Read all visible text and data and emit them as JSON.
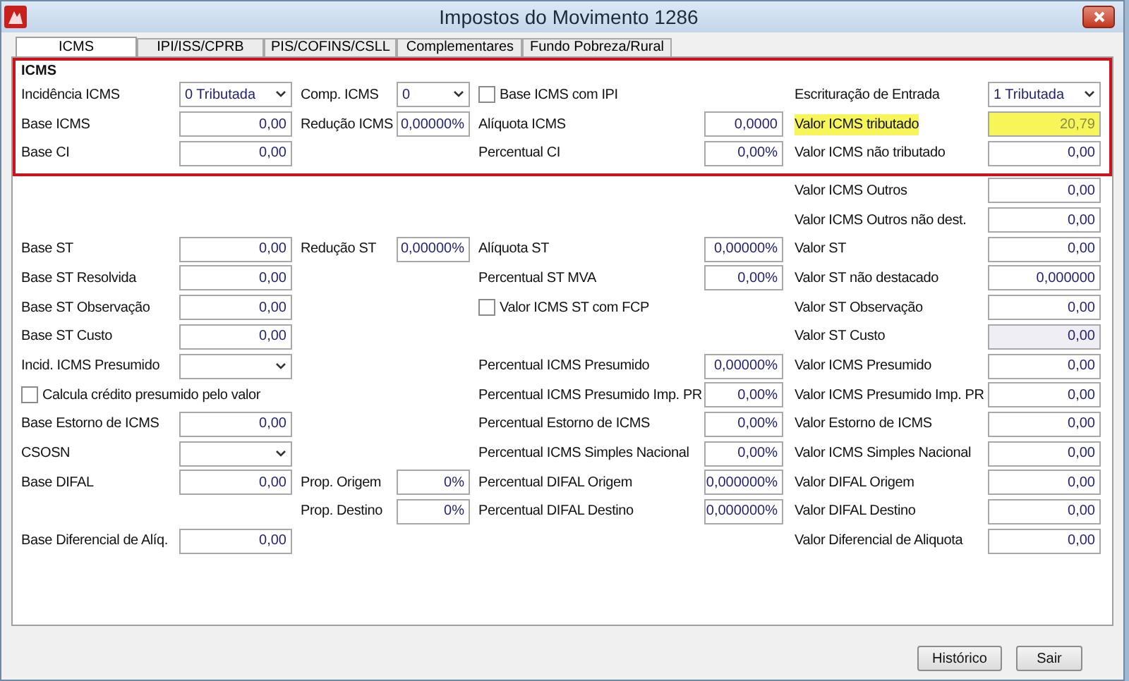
{
  "window": {
    "title": "Impostos do Movimento 1286"
  },
  "tabs": [
    {
      "label": "ICMS",
      "selected": true
    },
    {
      "label": "IPI/ISS/CPRB",
      "selected": false
    },
    {
      "label": "PIS/COFINS/CSLL",
      "selected": false
    },
    {
      "label": "Complementares",
      "selected": false
    },
    {
      "label": "Fundo Pobreza/Rural",
      "selected": false
    }
  ],
  "group": {
    "title": "ICMS",
    "outlined": true,
    "rows": [
      {
        "col_1": {
          "kind": "combo",
          "label": "Incidência ICMS",
          "value": "0 Tributada"
        },
        "col_2": {
          "kind": "combo",
          "label": "Comp. ICMS",
          "value": "0"
        },
        "col_3": {
          "kind": "checkbox",
          "label": "Base ICMS com IPI",
          "checked": false
        },
        "col_4": {
          "kind": "combo",
          "label": "Escrituração de Entrada",
          "value": "1 Tributada"
        }
      },
      {
        "col_1": {
          "kind": "field",
          "label": "Base ICMS",
          "value": "0,00"
        },
        "col_2": {
          "kind": "field",
          "label": "Redução ICMS",
          "value": "0,00000%"
        },
        "col_3": {
          "kind": "field",
          "label": "Alíquota ICMS",
          "value": "0,0000"
        },
        "col_4": {
          "kind": "field",
          "label": "Valor ICMS tributado",
          "value": "20,79",
          "highlighted": true
        }
      },
      {
        "col_1": {
          "kind": "field",
          "label": "Base CI",
          "value": "0,00"
        },
        "col_3": {
          "kind": "field",
          "label": "Percentual CI",
          "value": "0,00%"
        },
        "col_4": {
          "kind": "field",
          "label": "Valor ICMS não tributado",
          "value": "0,00"
        }
      }
    ]
  },
  "rows": [
    {
      "col_4": {
        "kind": "field",
        "label": "Valor ICMS Outros",
        "value": "0,00"
      }
    },
    {
      "col_4": {
        "kind": "field",
        "label": "Valor ICMS Outros não dest.",
        "value": "0,00"
      }
    },
    {
      "col_1": {
        "kind": "field",
        "label": "Base ST",
        "value": "0,00"
      },
      "col_2": {
        "kind": "field",
        "label": "Redução ST",
        "value": "0,00000%"
      },
      "col_3": {
        "kind": "field",
        "label": "Alíquota ST",
        "value": "0,00000%"
      },
      "col_4": {
        "kind": "field",
        "label": "Valor ST",
        "value": "0,00"
      }
    },
    {
      "col_1": {
        "kind": "field",
        "label": "Base ST Resolvida",
        "value": "0,00"
      },
      "col_3": {
        "kind": "field",
        "label": "Percentual ST MVA",
        "value": "0,00%"
      },
      "col_4": {
        "kind": "field",
        "label": "Valor ST não destacado",
        "value": "0,000000"
      }
    },
    {
      "col_1": {
        "kind": "field",
        "label": "Base ST Observação",
        "value": "0,00"
      },
      "col_3": {
        "kind": "checkbox",
        "label": "Valor ICMS ST com FCP",
        "checked": false
      },
      "col_4": {
        "kind": "field",
        "label": "Valor ST Observação",
        "value": "0,00"
      }
    },
    {
      "col_1": {
        "kind": "field",
        "label": "Base ST Custo",
        "value": "0,00"
      },
      "col_4": {
        "kind": "field",
        "label": "Valor ST Custo",
        "value": "0,00",
        "disabled": true
      }
    },
    {
      "col_1": {
        "kind": "combo",
        "label": "Incid. ICMS Presumido"
      },
      "col_3": {
        "kind": "field",
        "label": "Percentual ICMS Presumido",
        "value": "0,00000%"
      },
      "col_4": {
        "kind": "field",
        "label": "Valor ICMS Presumido",
        "value": "0,00"
      }
    },
    {
      "col_1": {
        "kind": "checkbox",
        "label": "Calcula crédito presumido pelo valor",
        "checked": false
      },
      "col_3": {
        "kind": "field",
        "label": "Percentual ICMS Presumido Imp. PR",
        "value": "0,00%"
      },
      "col_4": {
        "kind": "field",
        "label": "Valor ICMS Presumido Imp. PR",
        "value": "0,00"
      }
    },
    {
      "col_1": {
        "kind": "field",
        "label": "Base Estorno de ICMS",
        "value": "0,00"
      },
      "col_3": {
        "kind": "field",
        "label": "Percentual Estorno de ICMS",
        "value": "0,00%"
      },
      "col_4": {
        "kind": "field",
        "label": "Valor Estorno de ICMS",
        "value": "0,00"
      }
    },
    {
      "col_1": {
        "kind": "combo",
        "label": "CSOSN"
      },
      "col_3": {
        "kind": "field",
        "label": "Percentual ICMS Simples Nacional",
        "value": "0,00%"
      },
      "col_4": {
        "kind": "field",
        "label": "Valor ICMS Simples Nacional",
        "value": "0,00"
      }
    },
    {
      "col_1": {
        "kind": "field",
        "label": "Base DIFAL",
        "value": "0,00"
      },
      "col_2": {
        "kind": "field",
        "label": "Prop. Origem",
        "value": "0%"
      },
      "col_3": {
        "kind": "field",
        "label": "Percentual DIFAL Origem",
        "value": "0,000000%"
      },
      "col_4": {
        "kind": "field",
        "label": "Valor DIFAL Origem",
        "value": "0,00"
      }
    },
    {
      "col_2": {
        "kind": "field",
        "label": "Prop. Destino",
        "value": "0%"
      },
      "col_3": {
        "kind": "field",
        "label": "Percentual DIFAL Destino",
        "value": "0,000000%"
      },
      "col_4": {
        "kind": "field",
        "label": "Valor DIFAL Destino",
        "value": "0,00"
      }
    },
    {
      "col_1": {
        "kind": "field",
        "label": "Base Diferencial de Alíq.",
        "value": "0,00"
      },
      "col_4": {
        "kind": "field",
        "label": "Valor Diferencial de Aliquota",
        "value": "0,00"
      }
    }
  ],
  "buttons": [
    "Histórico",
    "Sair"
  ]
}
